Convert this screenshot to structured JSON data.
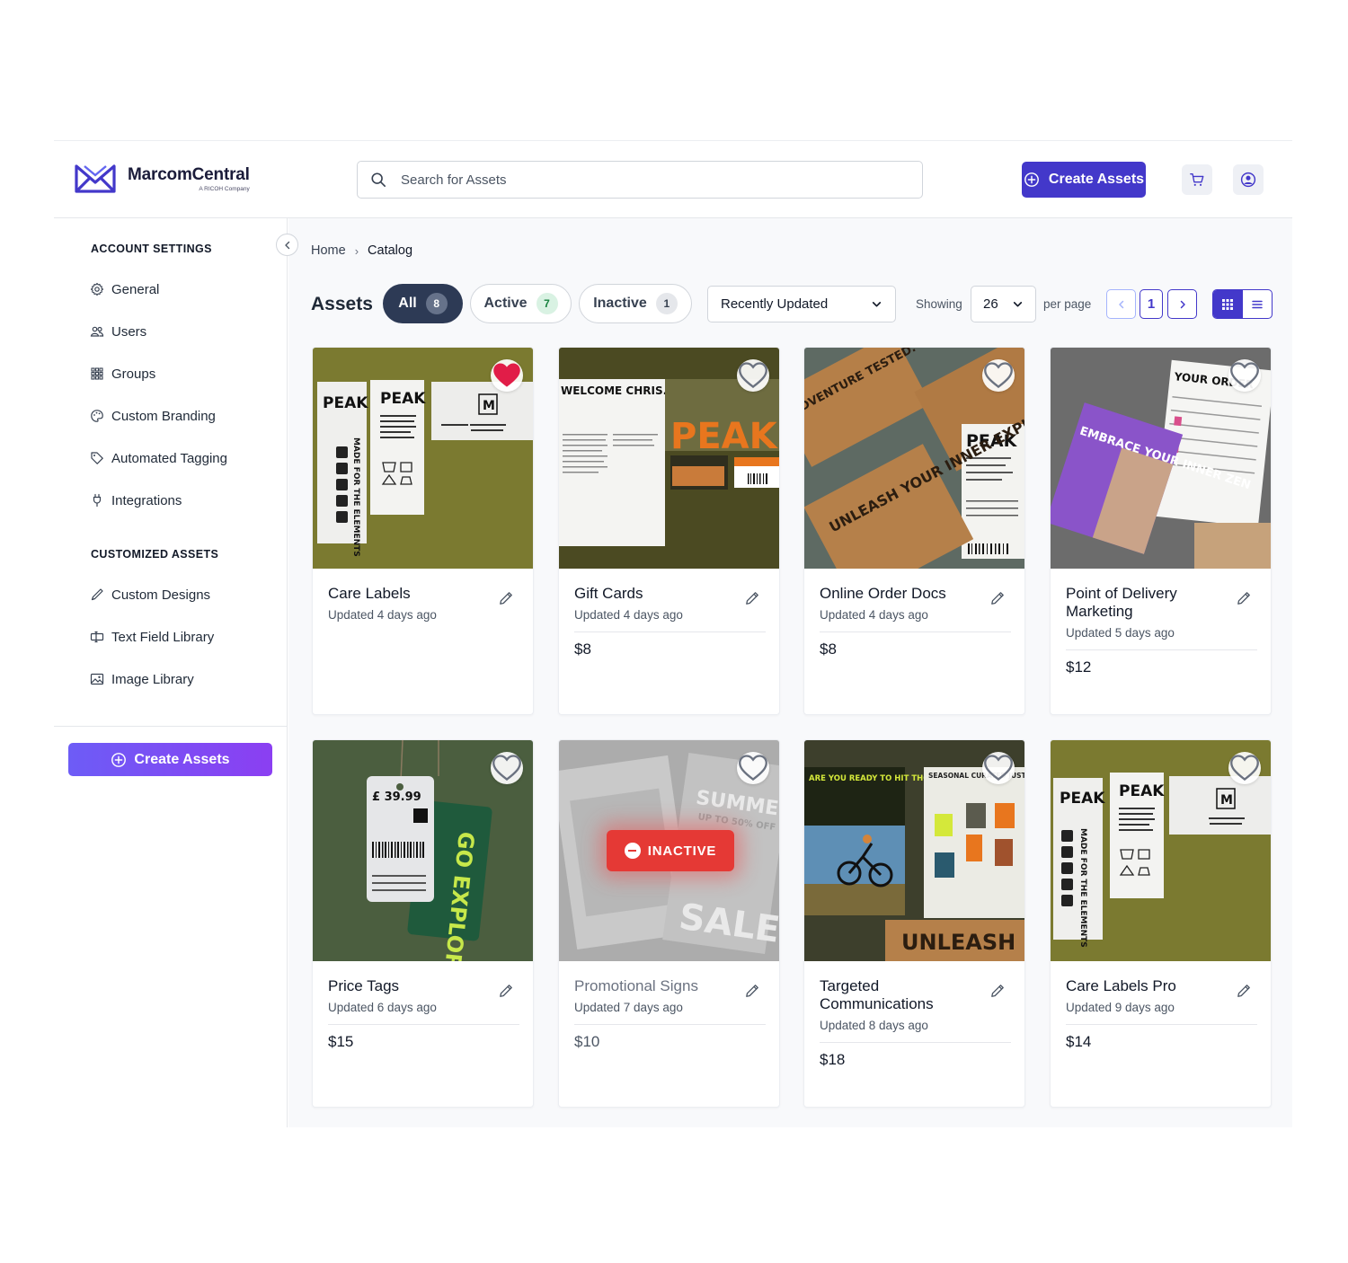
{
  "brand": {
    "name": "MarcomCentral",
    "subtitle": "A RICOH Company"
  },
  "search": {
    "placeholder": "Search for Assets"
  },
  "header": {
    "create_label": "Create Assets"
  },
  "sidebar": {
    "account_heading": "ACCOUNT SETTINGS",
    "account_items": [
      {
        "label": "General",
        "icon": "gear-icon"
      },
      {
        "label": "Users",
        "icon": "users-icon"
      },
      {
        "label": "Groups",
        "icon": "grid-icon"
      },
      {
        "label": "Custom Branding",
        "icon": "palette-icon"
      },
      {
        "label": "Automated Tagging",
        "icon": "tag-icon"
      },
      {
        "label": "Integrations",
        "icon": "plug-icon"
      }
    ],
    "assets_heading": "CUSTOMIZED ASSETS",
    "asset_items": [
      {
        "label": "Custom Designs",
        "icon": "pen-icon"
      },
      {
        "label": "Text Field Library",
        "icon": "text-field-icon"
      },
      {
        "label": "Image Library",
        "icon": "image-icon"
      }
    ],
    "create_label": "Create Assets"
  },
  "breadcrumb": {
    "home": "Home",
    "separator": "›",
    "current": "Catalog"
  },
  "toolbar": {
    "title": "Assets",
    "filters": [
      {
        "label": "All",
        "count": "8",
        "selected": true
      },
      {
        "label": "Active",
        "count": "7",
        "selected": false
      },
      {
        "label": "Inactive",
        "count": "1",
        "selected": false
      }
    ],
    "sort": "Recently Updated",
    "showing_label": "Showing",
    "per_page_value": "26",
    "per_page_label": "per page",
    "current_page": "1",
    "view_mode": "grid"
  },
  "cards": [
    {
      "title": "Care Labels",
      "updated": "Updated 4 days ago",
      "price": "",
      "favorite": true,
      "status": "active"
    },
    {
      "title": "Gift Cards",
      "updated": "Updated 4 days ago",
      "price": "$8",
      "favorite": false,
      "status": "active"
    },
    {
      "title": "Online Order Docs",
      "updated": "Updated 4 days ago",
      "price": "$8",
      "favorite": false,
      "status": "active"
    },
    {
      "title": "Point of Delivery Marketing",
      "updated": "Updated 5 days ago",
      "price": "$12",
      "favorite": false,
      "status": "active"
    },
    {
      "title": "Price Tags",
      "updated": "Updated 6 days ago",
      "price": "$15",
      "favorite": false,
      "status": "active"
    },
    {
      "title": "Promotional Signs",
      "updated": "Updated 7 days ago",
      "price": "$10",
      "favorite": false,
      "status": "inactive",
      "badge": "INACTIVE"
    },
    {
      "title": "Targeted Communications",
      "updated": "Updated 8 days ago",
      "price": "$18",
      "favorite": false,
      "status": "active"
    },
    {
      "title": "Care Labels Pro",
      "updated": "Updated 9 days ago",
      "price": "$14",
      "favorite": false,
      "status": "active"
    }
  ],
  "artwork_text": {
    "peak": "PEAK",
    "made_for": "MADE FOR THE ELEMENTS",
    "size_m": "M",
    "welcome": "WELCOME CHRIS.",
    "adventure": "ADVENTURE TESTED. STYLE APPROVED.",
    "unleash": "UNLEASH YOUR INNER EXPLORER.",
    "your_order": "YOUR ORDER",
    "embrace": "EMBRACE YOUR INNER ZEN",
    "price_tag": "£ 39.99",
    "go_explore": "GO EXPLORE",
    "summer": "SUMMER",
    "up_to": "UP TO 50% OFF",
    "sale": "SALE",
    "trails": "ARE YOU READY TO HIT THOSE FRESH TRAILS?",
    "seasonal": "SEASONAL CURATED JUST FOR YOU.",
    "unleash_short": "UNLEASH"
  },
  "colors": {
    "primary": "#4338ca",
    "accent_gradient_start": "#6d5cf6",
    "accent_gradient_end": "#8b3ff2",
    "favorite": "#e11d48",
    "inactive": "#e53935",
    "olive": "#7b7a2f"
  }
}
